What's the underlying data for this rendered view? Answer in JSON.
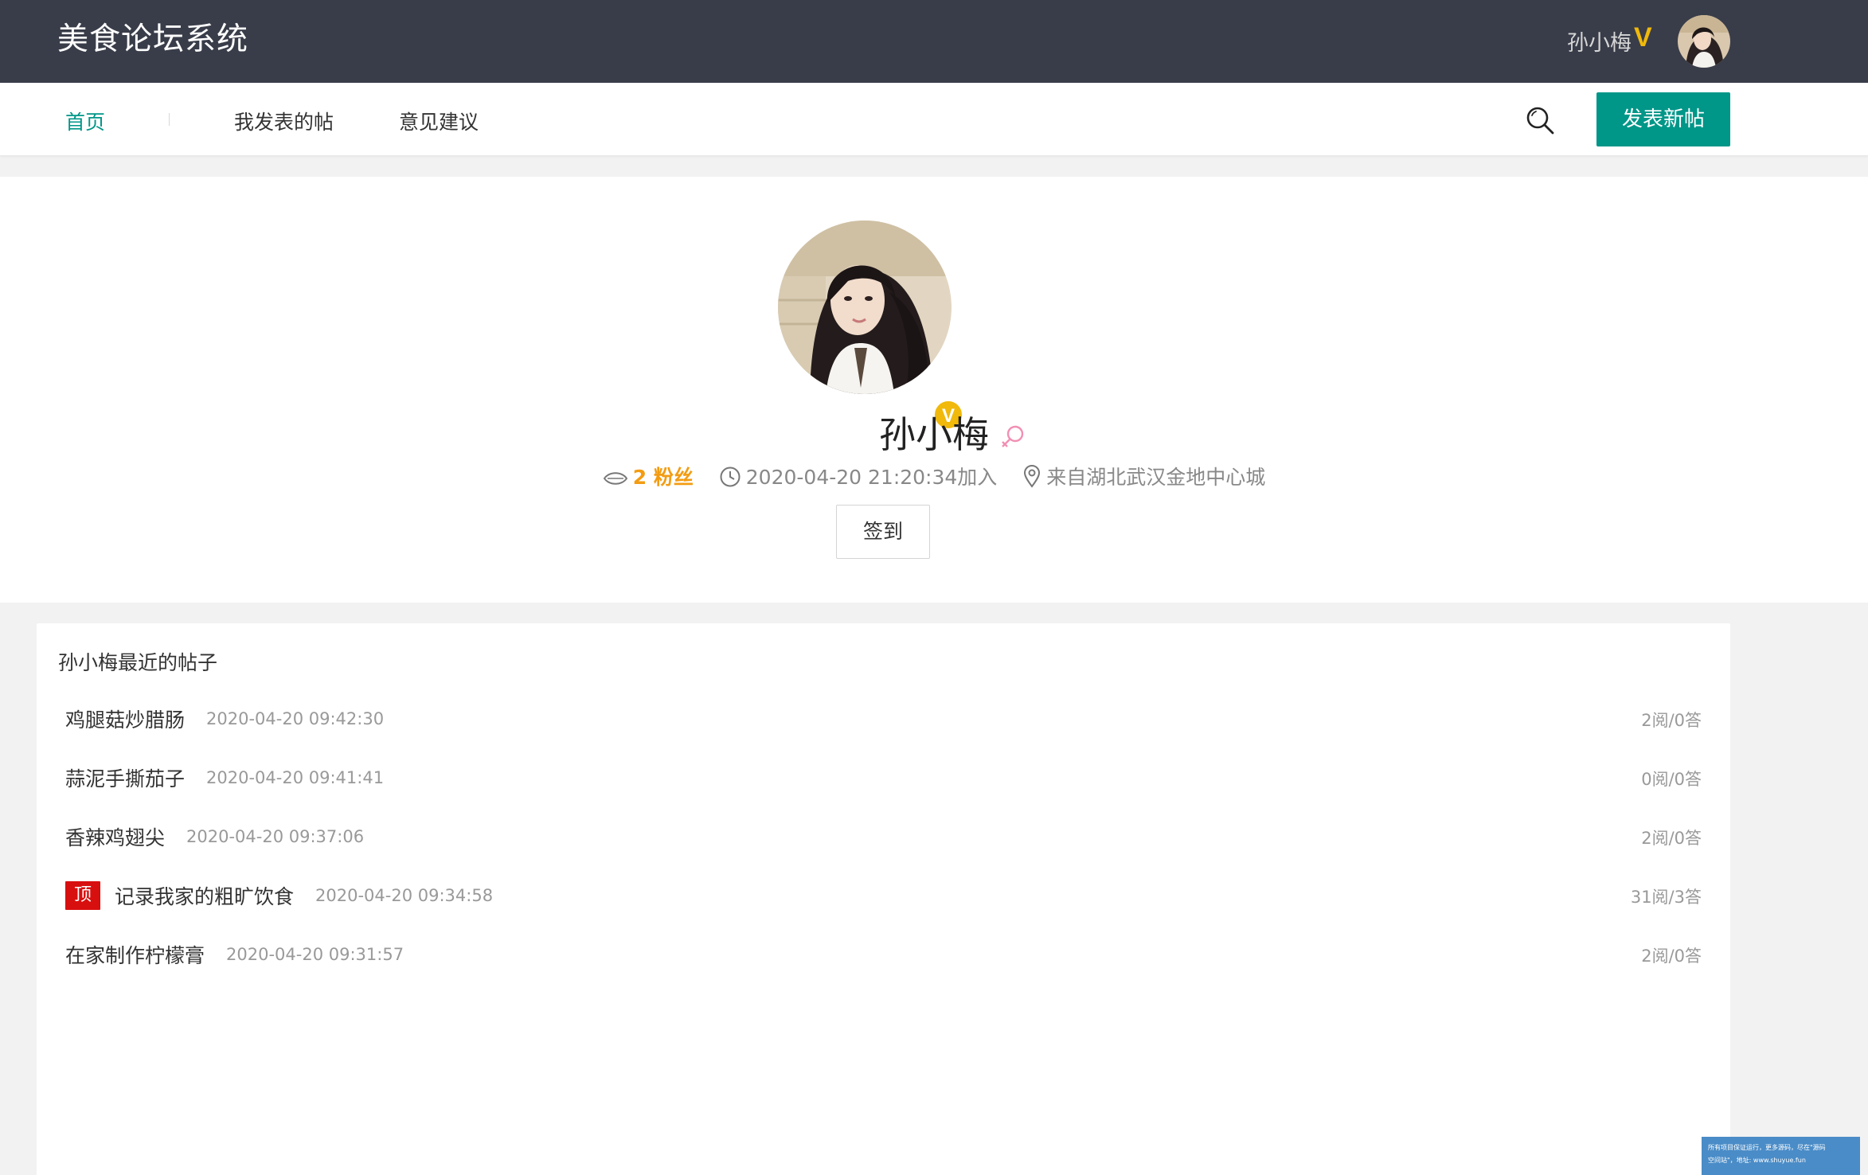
{
  "header": {
    "logo": "美食论坛系统",
    "user_name": "孙小梅",
    "vip_mark": "V"
  },
  "nav": {
    "items": [
      {
        "label": "首页",
        "active": true
      },
      {
        "label": "我发表的帖"
      },
      {
        "label": "意见建议"
      }
    ],
    "post_button": "发表新帖"
  },
  "profile": {
    "name": "孙小梅",
    "verified_badge": "V",
    "fans_label": "2 粉丝",
    "joined": "2020-04-20 21:20:34加入",
    "location": "来自湖北武汉金地中心城",
    "checkin_button": "签到"
  },
  "recent": {
    "title": "孙小梅最近的帖子",
    "top_tag": "顶",
    "posts": [
      {
        "title": "鸡腿菇炒腊肠",
        "time": "2020-04-20 09:42:30",
        "stats": "2阅/0答"
      },
      {
        "title": "蒜泥手撕茄子",
        "time": "2020-04-20 09:41:41",
        "stats": "0阅/0答"
      },
      {
        "title": "香辣鸡翅尖",
        "time": "2020-04-20 09:37:06",
        "stats": "2阅/0答"
      },
      {
        "title": "记录我家的粗旷饮食",
        "time": "2020-04-20 09:34:58",
        "stats": "31阅/3答"
      },
      {
        "title": "在家制作柠檬膏",
        "time": "2020-04-20 09:31:57",
        "stats": "2阅/0答"
      }
    ]
  },
  "watermark": {
    "line1": "所有项目保证运行，更多源码，尽在\"源码",
    "line2": "空间站\"，地址: www.shuyue.fun"
  },
  "colors": {
    "header_bg": "#393d49",
    "accent": "#009688",
    "vip": "#f0b90b",
    "top_tag": "#d80f0f",
    "fans": "#f39c12"
  }
}
